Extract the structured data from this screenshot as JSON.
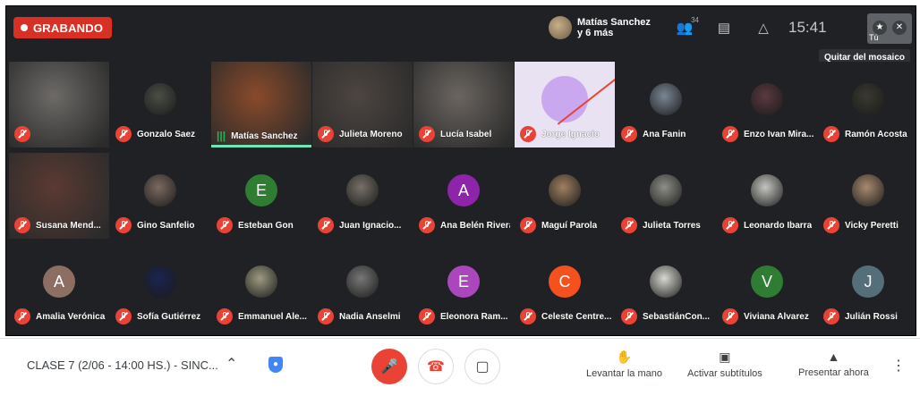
{
  "recording": {
    "label": "GRABANDO"
  },
  "presenter": {
    "name": "Matías Sanchez",
    "more": "y 6 más"
  },
  "top": {
    "people_count": "34",
    "time": "15:41",
    "self_label": "Tú",
    "tooltip": "Quitar del mosaico",
    "people_icon": "people-icon",
    "chat_icon": "chat-icon",
    "activities_icon": "shapes-icon"
  },
  "participants": [
    {
      "name": "",
      "type": "photo",
      "color": "#6d6a67",
      "muted": true
    },
    {
      "name": "Gonzalo Saez",
      "type": "photo-small",
      "color": "#4a4f45",
      "muted": true
    },
    {
      "name": "Matías Sanchez",
      "type": "photo",
      "color": "#8a4a2a",
      "muted": false,
      "speaking": true
    },
    {
      "name": "Julieta Moreno",
      "type": "photo",
      "color": "#4d4540",
      "muted": true
    },
    {
      "name": "Lucía Isabel",
      "type": "photo",
      "color": "#6b6560",
      "muted": true
    },
    {
      "name": "Jorge Ignacio",
      "type": "camoff",
      "color": "#c9a8f0",
      "muted": true
    },
    {
      "name": "Ana Fanin",
      "type": "photo-small",
      "color": "#7a8794",
      "muted": true
    },
    {
      "name": "Enzo Ivan Mira...",
      "type": "photo-small",
      "color": "#5a3a40",
      "muted": true
    },
    {
      "name": "Ramón Acosta",
      "type": "photo-small",
      "color": "#3a3a30",
      "muted": true
    },
    {
      "name": "Susana Mend...",
      "type": "photo",
      "color": "#5b3a32",
      "muted": true
    },
    {
      "name": "Gino Sanfelio",
      "type": "photo-small",
      "color": "#7b6a60",
      "muted": true
    },
    {
      "name": "Esteban Gon",
      "type": "avatar",
      "initial": "E",
      "color": "#2e7d32",
      "muted": true
    },
    {
      "name": "Juan Ignacio...",
      "type": "photo-small",
      "color": "#777066",
      "muted": true
    },
    {
      "name": "Ana Belén Rivera",
      "type": "avatar",
      "initial": "A",
      "color": "#8e24aa",
      "muted": true
    },
    {
      "name": "Maguí Parola",
      "type": "photo-small",
      "color": "#a08060",
      "muted": true
    },
    {
      "name": "Julieta Torres",
      "type": "photo-small",
      "color": "#8f8f88",
      "muted": true
    },
    {
      "name": "Leonardo Ibarra",
      "type": "photo-small",
      "color": "#c5c5c0",
      "muted": true
    },
    {
      "name": "Vicky Peretti",
      "type": "photo-small",
      "color": "#a88a70",
      "muted": true
    },
    {
      "name": "Amalia Verónica...",
      "type": "avatar",
      "initial": "A",
      "color": "#8d6e63",
      "muted": true
    },
    {
      "name": "Sofía Gutiérrez",
      "type": "photo-small",
      "color": "#1b2550",
      "muted": true
    },
    {
      "name": "Emmanuel Ale...",
      "type": "photo-small",
      "color": "#9e9a80",
      "muted": true
    },
    {
      "name": "Nadia Anselmi",
      "type": "photo-small",
      "color": "#777777",
      "muted": true
    },
    {
      "name": "Eleonora Ram...",
      "type": "avatar",
      "initial": "E",
      "color": "#ab47bc",
      "muted": true
    },
    {
      "name": "Celeste Centre...",
      "type": "avatar",
      "initial": "C",
      "color": "#f4511e",
      "muted": true
    },
    {
      "name": "SebastiánCon...",
      "type": "photo-small",
      "color": "#d8d8d0",
      "muted": true
    },
    {
      "name": "Viviana Alvarez",
      "type": "avatar",
      "initial": "V",
      "color": "#2e7d32",
      "muted": true
    },
    {
      "name": "Julián Rossi",
      "type": "avatar",
      "initial": "J",
      "color": "#546e7a",
      "muted": true
    }
  ],
  "bottom": {
    "meeting_name": "CLASE 7 (2/06 - 14:00 HS.) - SINC...",
    "raise_hand": "Levantar la mano",
    "captions": "Activar subtítulos",
    "present": "Presentar ahora"
  }
}
